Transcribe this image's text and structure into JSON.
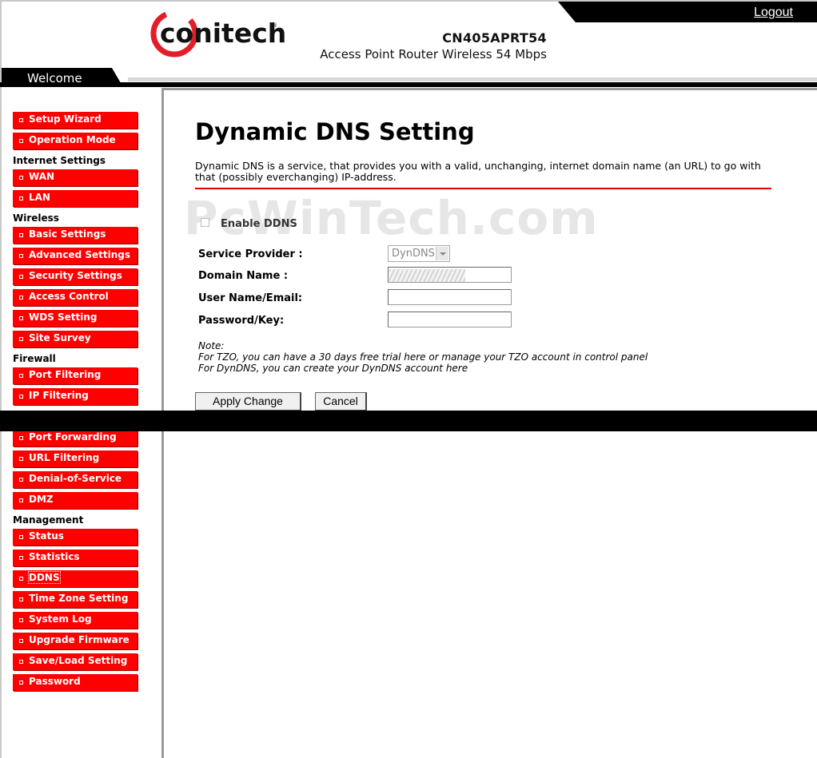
{
  "header": {
    "logout": "Logout",
    "logo_text": "conitech",
    "model": "CN405APRT54",
    "subtitle": "Access Point Router Wireless 54 Mbps",
    "welcome": "Welcome"
  },
  "sidebar": {
    "setup_wizard": "Setup Wizard",
    "operation_mode": "Operation Mode",
    "section_internet": "Internet Settings",
    "wan": "WAN",
    "lan": "LAN",
    "section_wireless": "Wireless",
    "basic_settings": "Basic Settings",
    "advanced_settings": "Advanced Settings",
    "security_settings": "Security Settings",
    "access_control": "Access Control",
    "wds_setting": "WDS Setting",
    "site_survey": "Site Survey",
    "section_firewall": "Firewall",
    "port_filtering": "Port Filtering",
    "ip_filtering": "IP Filtering",
    "port_forwarding": "Port Forwarding",
    "url_filtering": "URL Filtering",
    "denial_of_service": "Denial-of-Service",
    "dmz": "DMZ",
    "section_management": "Management",
    "status": "Status",
    "statistics": "Statistics",
    "ddns": "DDNS",
    "time_zone_setting": "Time Zone Setting",
    "system_log": "System Log",
    "upgrade_firmware": "Upgrade Firmware",
    "save_load_setting": "Save/Load Setting",
    "password": "Password",
    "active": "DDNS"
  },
  "main": {
    "title": "Dynamic DNS Setting",
    "description": "Dynamic DNS is a service, that provides you with a valid, unchanging, internet domain name (an URL) to go with that (possibly everchanging) IP-address.",
    "watermark": "PcWinTech.com",
    "enable_label": "Enable DDNS",
    "enable_checked": false,
    "service_provider_label": "Service Provider :",
    "service_provider_value": "DynDNS",
    "domain_name_label": "Domain Name :",
    "user_label": "User Name/Email:",
    "password_label": "Password/Key:",
    "note_title": "Note:",
    "note_tzo": "For TZO, you can have a 30 days free trial here or manage your TZO account in control panel",
    "note_dyndns": "For DynDNS, you can create your DynDNS account here",
    "apply_button": "Apply Change",
    "cancel_button": "Cancel"
  },
  "colors": {
    "menu_red": "#ff0000",
    "rule_red": "#e00000",
    "logo_red": "#e41e26"
  }
}
